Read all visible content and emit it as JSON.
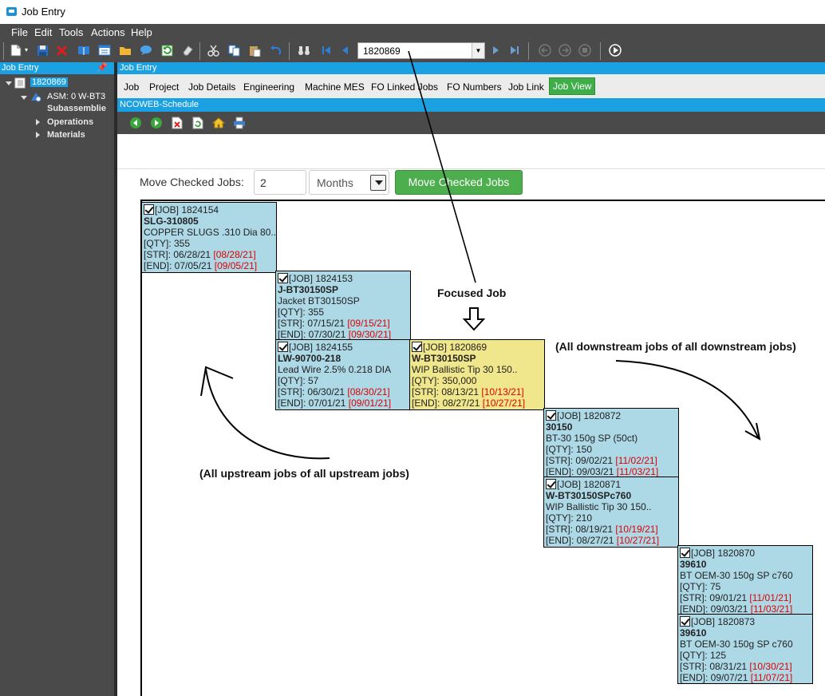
{
  "window": {
    "title": "Job Entry"
  },
  "menu": [
    "File",
    "Edit",
    "Tools",
    "Actions",
    "Help"
  ],
  "toolbar": {
    "job_number": "1820869"
  },
  "left_panel": {
    "header": "Job Entry",
    "tree": {
      "root": "1820869",
      "asm": "ASM: 0 W-BT3",
      "subassemblies": "Subassemblie",
      "operations": "Operations",
      "materials": "Materials"
    }
  },
  "right_panel": {
    "header": "Job Entry",
    "tabs": [
      "Job",
      "Project",
      "Job Details",
      "Engineering",
      "Machine MES",
      "FO Linked Jobs",
      "FO Numbers",
      "Job Link",
      "Job View"
    ],
    "active_tab": "Job View",
    "sub_header": "NCOWEB-Schedule"
  },
  "move": {
    "label": "Move Checked Jobs:",
    "value": "2",
    "unit": "Months",
    "button": "Move Checked Jobs"
  },
  "jobs": [
    {
      "job": "[JOB] 1824154",
      "part": "SLG-310805",
      "desc": "COPPER SLUGS .310 Dia 80..",
      "qty": "[QTY]: 355",
      "str": "[STR]: 06/28/21",
      "str_new": "[08/28/21]",
      "end": "[END]: 07/05/21",
      "end_new": "[09/05/21]"
    },
    {
      "job": "[JOB] 1824153",
      "part": "J-BT30150SP",
      "desc": "Jacket BT30150SP",
      "qty": "[QTY]: 355",
      "str": "[STR]: 07/15/21",
      "str_new": "[09/15/21]",
      "end": "[END]: 07/30/21",
      "end_new": "[09/30/21]"
    },
    {
      "job": "[JOB] 1824155",
      "part": "LW-90700-218",
      "desc": "Lead Wire 2.5% 0.218 DIA",
      "qty": "[QTY]: 57",
      "str": "[STR]: 06/30/21",
      "str_new": "[08/30/21]",
      "end": "[END]: 07/01/21",
      "end_new": "[09/01/21]"
    },
    {
      "job": "[JOB] 1820869",
      "part": "W-BT30150SP",
      "desc": "WIP Ballistic Tip 30 150..",
      "qty": "[QTY]: 350,000",
      "str": "[STR]: 08/13/21",
      "str_new": "[10/13/21]",
      "end": "[END]: 08/27/21",
      "end_new": "[10/27/21]"
    },
    {
      "job": "[JOB] 1820872",
      "part": "30150",
      "desc": "BT-30 150g SP (50ct)",
      "qty": "[QTY]: 150",
      "str": "[STR]: 09/02/21",
      "str_new": "[11/02/21]",
      "end": "[END]: 09/03/21",
      "end_new": "[11/03/21]"
    },
    {
      "job": "[JOB] 1820871",
      "part": "W-BT30150SPc760",
      "desc": "WIP Ballistic Tip 30 150..",
      "qty": "[QTY]: 210",
      "str": "[STR]: 08/19/21",
      "str_new": "[10/19/21]",
      "end": "[END]: 08/27/21",
      "end_new": "[10/27/21]"
    },
    {
      "job": "[JOB] 1820870",
      "part": "39610",
      "desc": "BT OEM-30 150g SP c760",
      "qty": "[QTY]: 75",
      "str": "[STR]: 09/01/21",
      "str_new": "[11/01/21]",
      "end": "[END]: 09/03/21",
      "end_new": "[11/03/21]"
    },
    {
      "job": "[JOB] 1820873",
      "part": "39610",
      "desc": "BT OEM-30 150g SP c760",
      "qty": "[QTY]: 125",
      "str": "[STR]: 08/31/21",
      "str_new": "[10/30/21]",
      "end": "[END]: 09/07/21",
      "end_new": "[11/07/21]"
    }
  ],
  "annotations": {
    "focused": "Focused Job",
    "downstream": "(All downstream jobs of all downstream jobs)",
    "upstream": "(All upstream jobs of all upstream jobs)"
  }
}
